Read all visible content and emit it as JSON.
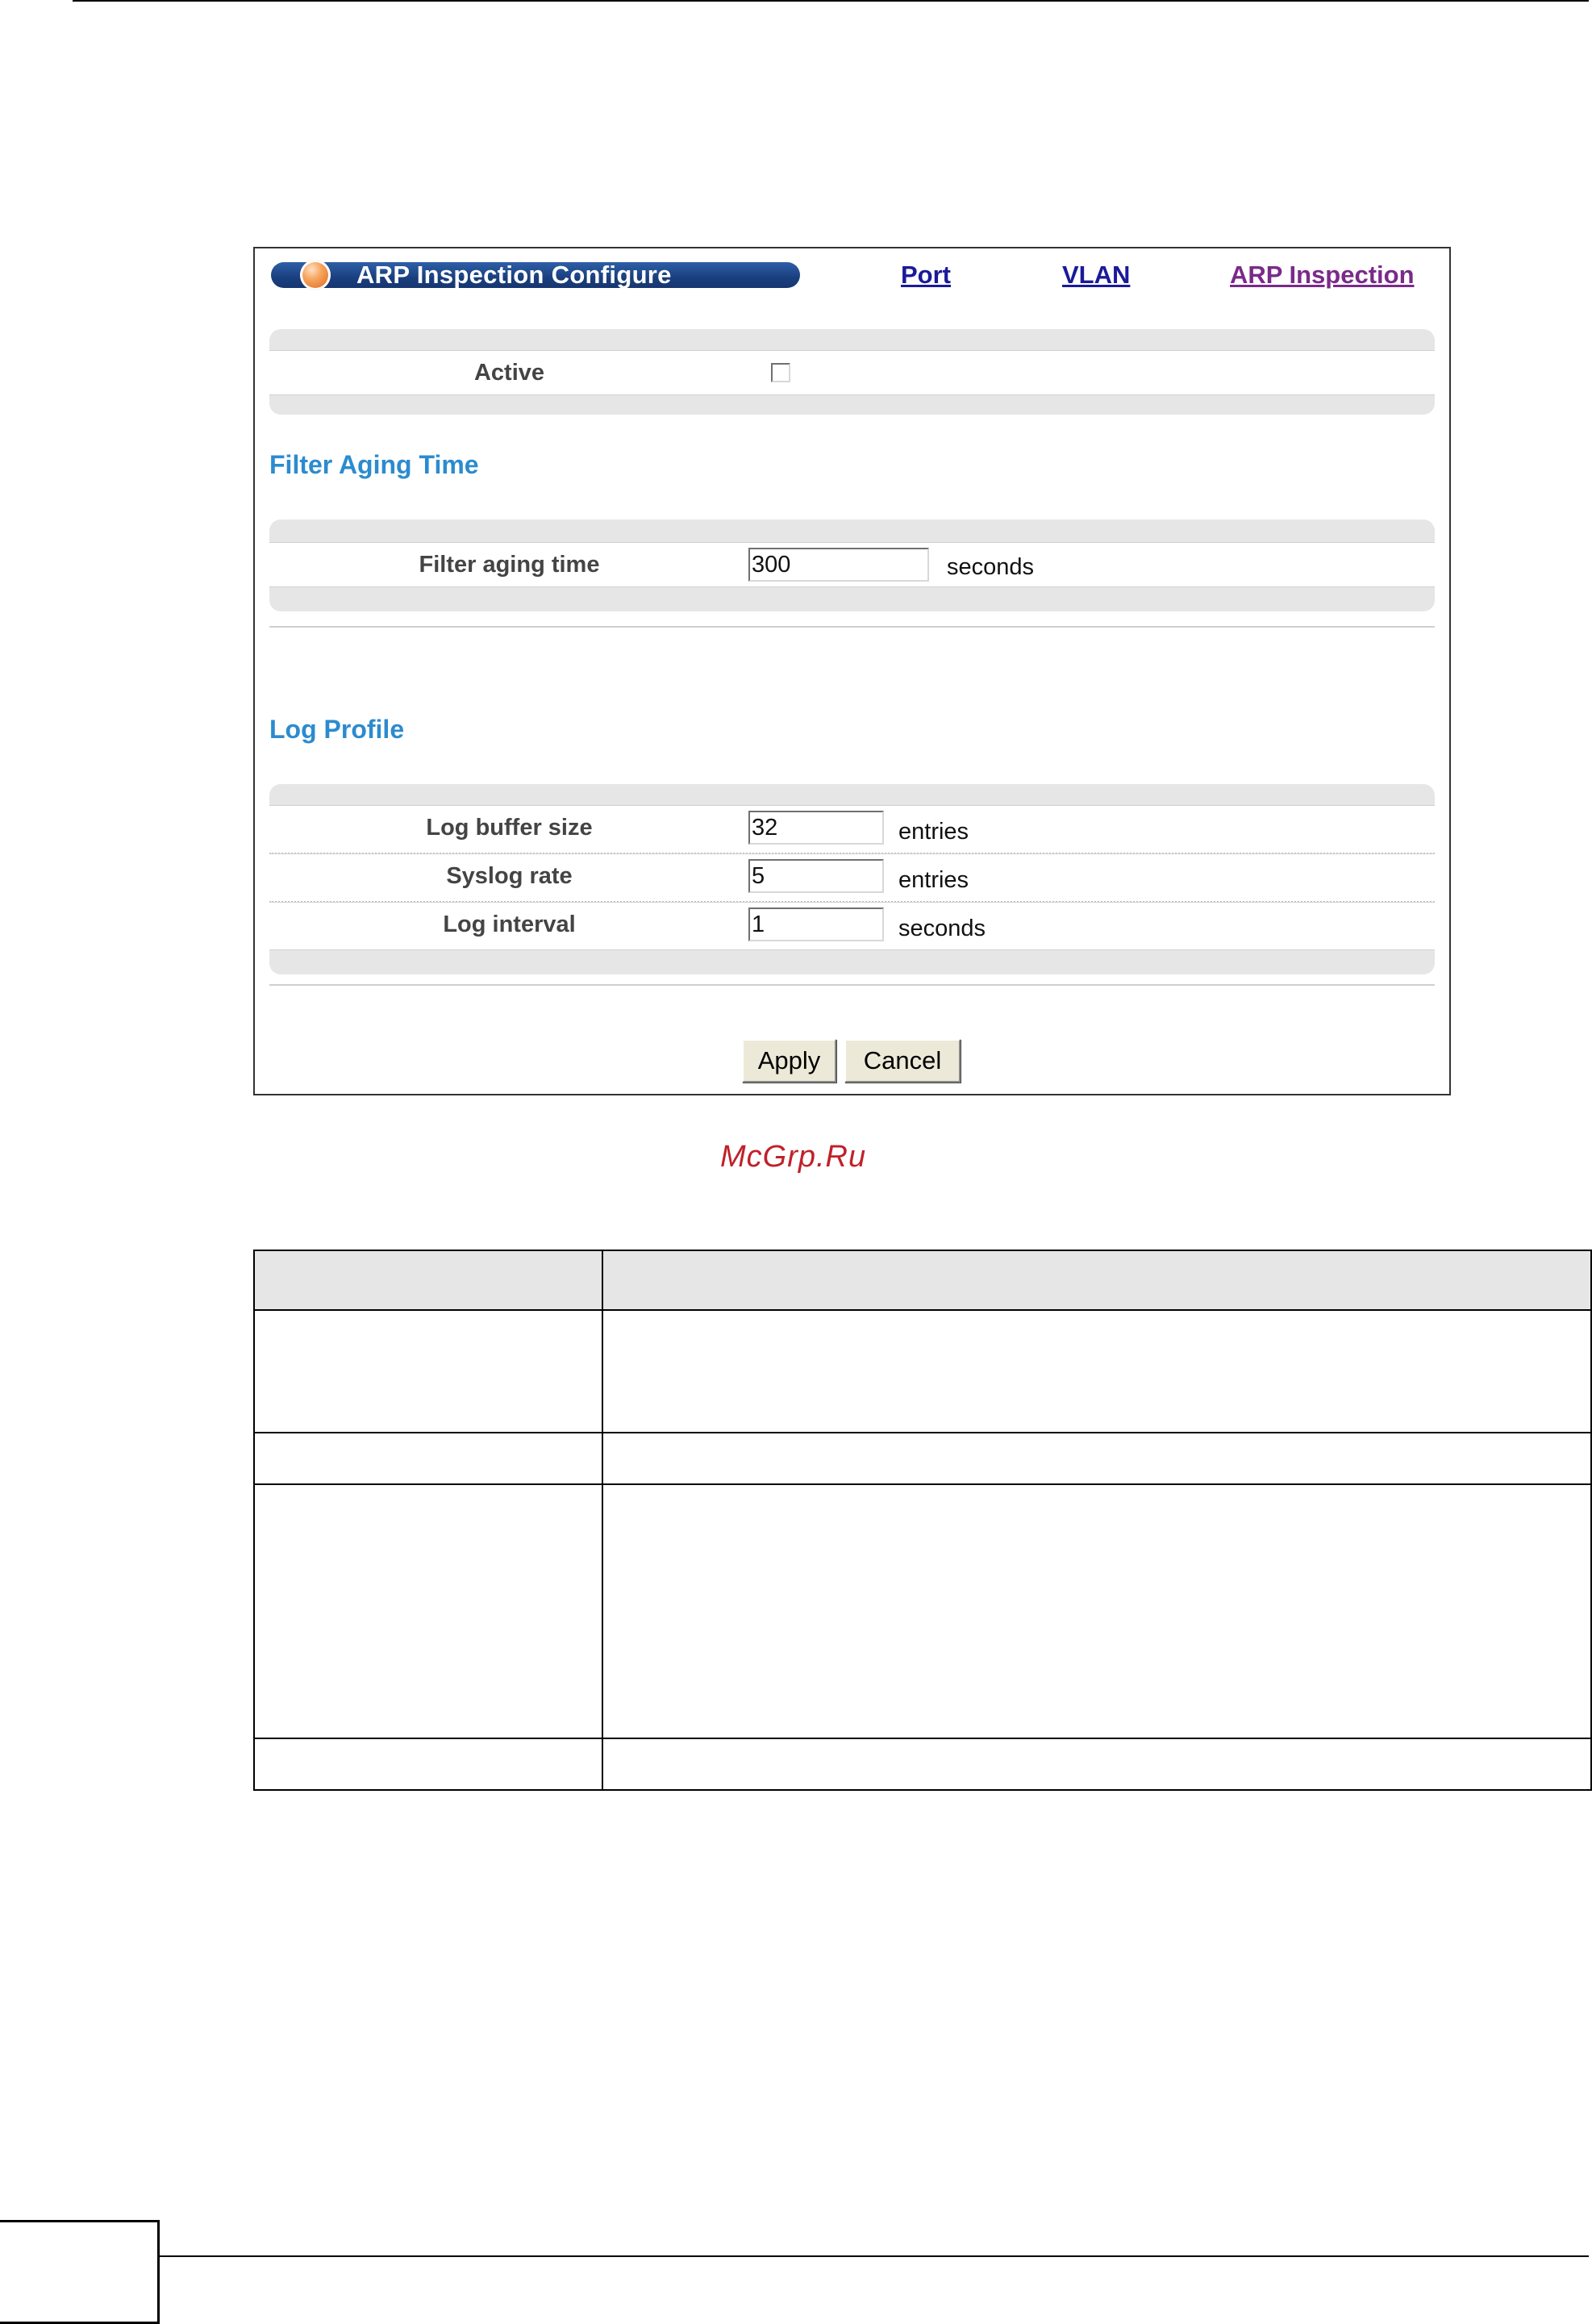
{
  "screen": {
    "title": "ARP Inspection Configure",
    "nav_links": {
      "port": "Port",
      "vlan": "VLAN",
      "arp_inspection": "ARP Inspection"
    },
    "active": {
      "label": "Active",
      "checked": false
    },
    "filter_aging": {
      "section_title": "Filter Aging Time",
      "label": "Filter aging time",
      "value": "300",
      "unit": "seconds"
    },
    "log_profile": {
      "section_title": "Log Profile",
      "rows": [
        {
          "label": "Log buffer size",
          "value": "32",
          "unit": "entries"
        },
        {
          "label": "Syslog rate",
          "value": "5",
          "unit": "entries"
        },
        {
          "label": "Log interval",
          "value": "1",
          "unit": "seconds"
        }
      ]
    },
    "buttons": {
      "apply": "Apply",
      "cancel": "Cancel"
    }
  },
  "watermark": "McGrp.Ru"
}
